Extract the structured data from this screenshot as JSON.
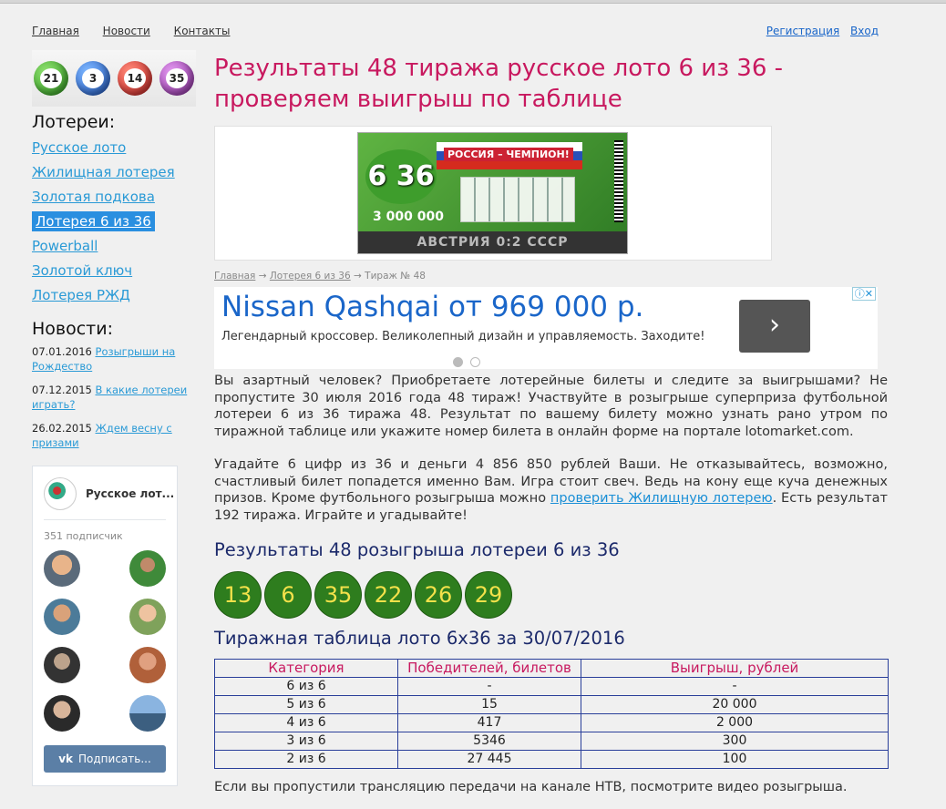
{
  "nav": {
    "left": [
      "Главная",
      "Новости",
      "Контакты"
    ],
    "right": [
      "Регистрация",
      "Вход"
    ]
  },
  "sidebar": {
    "balls": [
      "21",
      "3",
      "14",
      "35"
    ],
    "lotteries_heading": "Лотереи:",
    "lotteries": [
      "Русское лото",
      "Жилищная лотерея",
      "Золотая подкова",
      "Лотерея 6 из 36",
      "Powerball",
      "Золотой ключ",
      "Лотерея РЖД"
    ],
    "active_lottery_index": 3,
    "news_heading": "Новости:",
    "news": [
      {
        "date": "07.01.2016",
        "title": "Розыгрыши на Рождество"
      },
      {
        "date": "07.12.2015",
        "title": "В какие лотереи играть?"
      },
      {
        "date": "26.02.2015",
        "title": "Ждем весну с призами"
      }
    ],
    "vk": {
      "group_name": "Русское лот...",
      "subscribers": "351 подписчик",
      "subscribe": "Подписать..."
    }
  },
  "main": {
    "title": "Результаты 48 тиража русское лото 6 из 36 - проверяем выигрыш по таблице",
    "ticket": {
      "logo": "6 36",
      "banner_text": "РОССИЯ – ЧЕМПИОН!",
      "prize": "3 000 000",
      "bottom": "АВСТРИЯ 0:2 СССР"
    },
    "breadcrumbs": [
      "Главная",
      "Лотерея 6 из 36",
      "Тираж № 48"
    ],
    "ad": {
      "title": "Nissan Qashqai от 969 000 р.",
      "text": "Легендарный кроссовер. Великолепный дизайн и управляемость. Заходите!",
      "button": "›",
      "close": "ⓘ✕"
    },
    "para1": "Вы азартный человек? Приобретаете лотерейные билеты и следите за выигрышами? Не пропустите 30 июля 2016 года 48 тираж! Участвуйте в розыгрыше суперприза футбольной лотереи 6 из 36 тиража 48. Результат по вашему билету можно узнать рано утром по тиражной таблице или укажите номер билета в онлайн форме на портале lotomarket.com.",
    "para2_before": "Угадайте 6 цифр из 36 и деньги 4 856 850 рублей Ваши. Не отказывайтесь, возможно, счастливый билет попадется именно Вам. Игра стоит свеч. Ведь на кону еще куча денежных призов. Кроме футбольного розыгрыша можно ",
    "para2_link": "проверить Жилищную лотерею",
    "para2_after": ". Есть результат 192 тиража. Играйте и угадывайте!",
    "results_heading": "Результаты 48 розыгрыша лотереи 6 из 36",
    "numbers": [
      "13",
      "6",
      "35",
      "22",
      "26",
      "29"
    ],
    "table_heading": "Тиражная таблица лото 6х36 за 30/07/2016",
    "table": {
      "headers": [
        "Категория",
        "Победителей, билетов",
        "Выигрыш, рублей"
      ],
      "rows": [
        [
          "6 из 6",
          "-",
          "-"
        ],
        [
          "5 из 6",
          "15",
          "20 000"
        ],
        [
          "4 из 6",
          "417",
          "2 000"
        ],
        [
          "3 из 6",
          "5346",
          "300"
        ],
        [
          "2 из 6",
          "27 445",
          "100"
        ]
      ]
    },
    "footer_text": "Если вы пропустили трансляцию передачи на канале НТВ, посмотрите видео розыгрыша."
  },
  "colors": {
    "title": "#c8195f",
    "link": "#2a9ad6",
    "heading": "#1c2a6b",
    "ball": "#2e7d1e",
    "ball_text": "#f3e14a"
  }
}
